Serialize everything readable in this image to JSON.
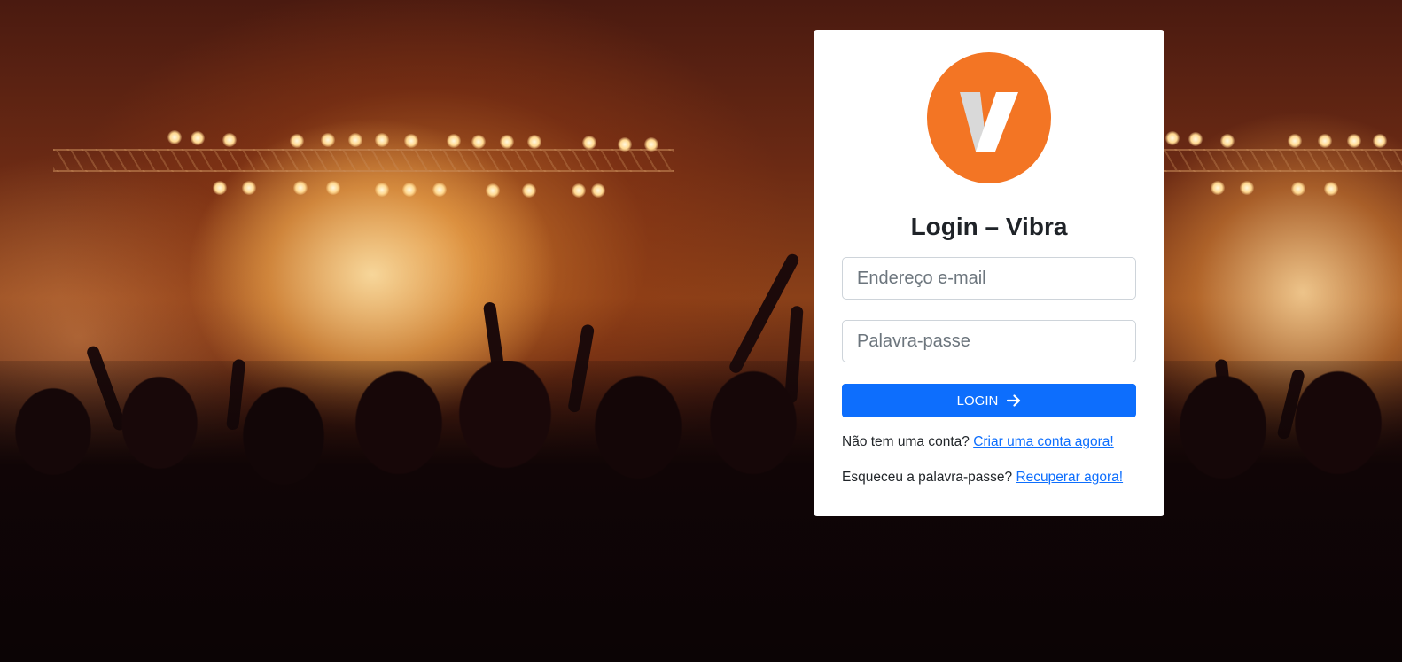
{
  "app": {
    "title": "Login – Vibra",
    "brand_color": "#f37524",
    "accent_color": "#0d6efd"
  },
  "logo": {
    "icon": "vibra-v-logo",
    "letter": "V"
  },
  "form": {
    "email_placeholder": "Endereço e-mail",
    "email_value": "",
    "password_placeholder": "Palavra-passe",
    "password_value": "",
    "login_label": "LOGIN",
    "login_icon": "arrow-right-icon"
  },
  "links": {
    "signup_prompt": "Não tem uma conta?",
    "signup_link": "Criar uma conta agora!",
    "recover_prompt": "Esqueceu a palavra-passe?",
    "recover_link": "Recuperar agora!"
  },
  "background": {
    "image": "concert-crowd-stage-lights"
  }
}
